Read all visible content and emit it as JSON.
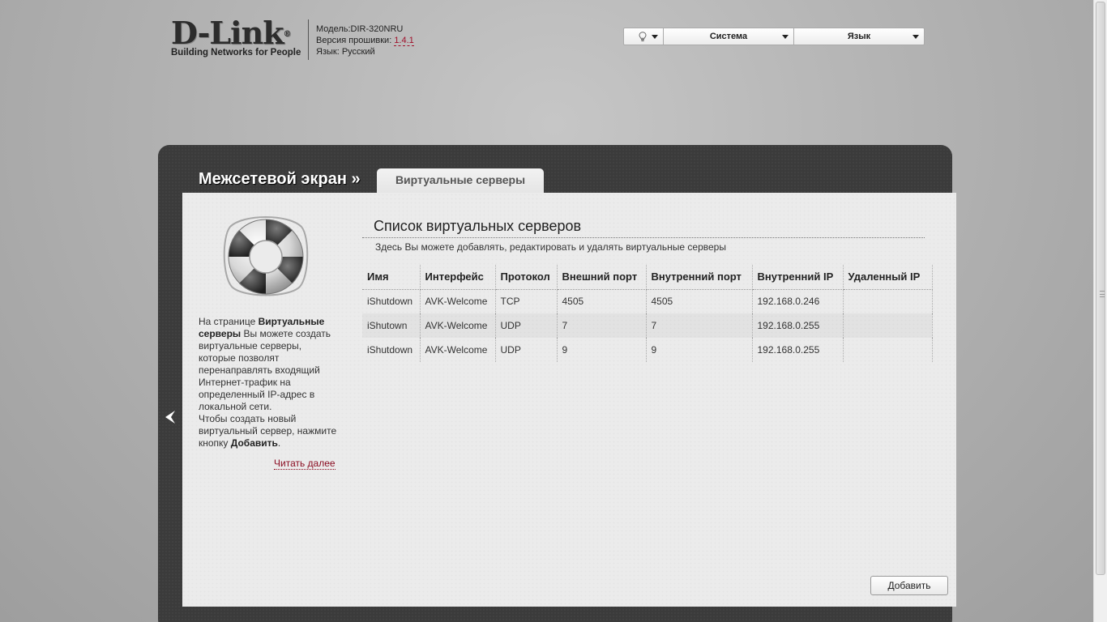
{
  "header": {
    "brand": "D-Link",
    "brand_mark": "®",
    "tagline": "Building Networks for People",
    "model_label": "Модель:",
    "model_value": "DIR-320NRU",
    "firmware_label": "Версия прошивки:",
    "firmware_value": "1.4.1",
    "language_label": "Язык:",
    "language_value": "Русский"
  },
  "topmenu": {
    "bulb_icon": "lightbulb-icon",
    "system_label": "Система",
    "language_label": "Язык"
  },
  "nav": {
    "breadcrumb": "Межсетевой экран »",
    "active_tab": "Виртуальные серверы"
  },
  "help": {
    "p1_prefix": "На странице ",
    "p1_bold": "Виртуальные серверы",
    "p1_suffix": " Вы можете создать виртуальные серверы, которые позволят перенаправлять входящий Интернет-трафик на определенный IP-адрес в локальной сети.",
    "p2_prefix": "Чтобы создать новый виртуальный сервер, нажмите кнопку ",
    "p2_bold": "Добавить",
    "p2_suffix": ".",
    "read_more": "Читать далее"
  },
  "main": {
    "title": "Список виртуальных серверов",
    "description": "Здесь Вы можете добавлять, редактировать и удалять виртуальные серверы",
    "columns": [
      "Имя",
      "Интерфейс",
      "Протокол",
      "Внешний порт",
      "Внутренний порт",
      "Внутренний IP",
      "Удаленный IP"
    ],
    "rows": [
      [
        "iShutdown",
        "AVK-Welcome",
        "TCP",
        "4505",
        "4505",
        "192.168.0.246",
        ""
      ],
      [
        "iShutown",
        "AVK-Welcome",
        "UDP",
        "7",
        "7",
        "192.168.0.255",
        ""
      ],
      [
        "iShutdown",
        "AVK-Welcome",
        "UDP",
        "9",
        "9",
        "192.168.0.255",
        ""
      ]
    ],
    "add_button": "Добавить"
  }
}
